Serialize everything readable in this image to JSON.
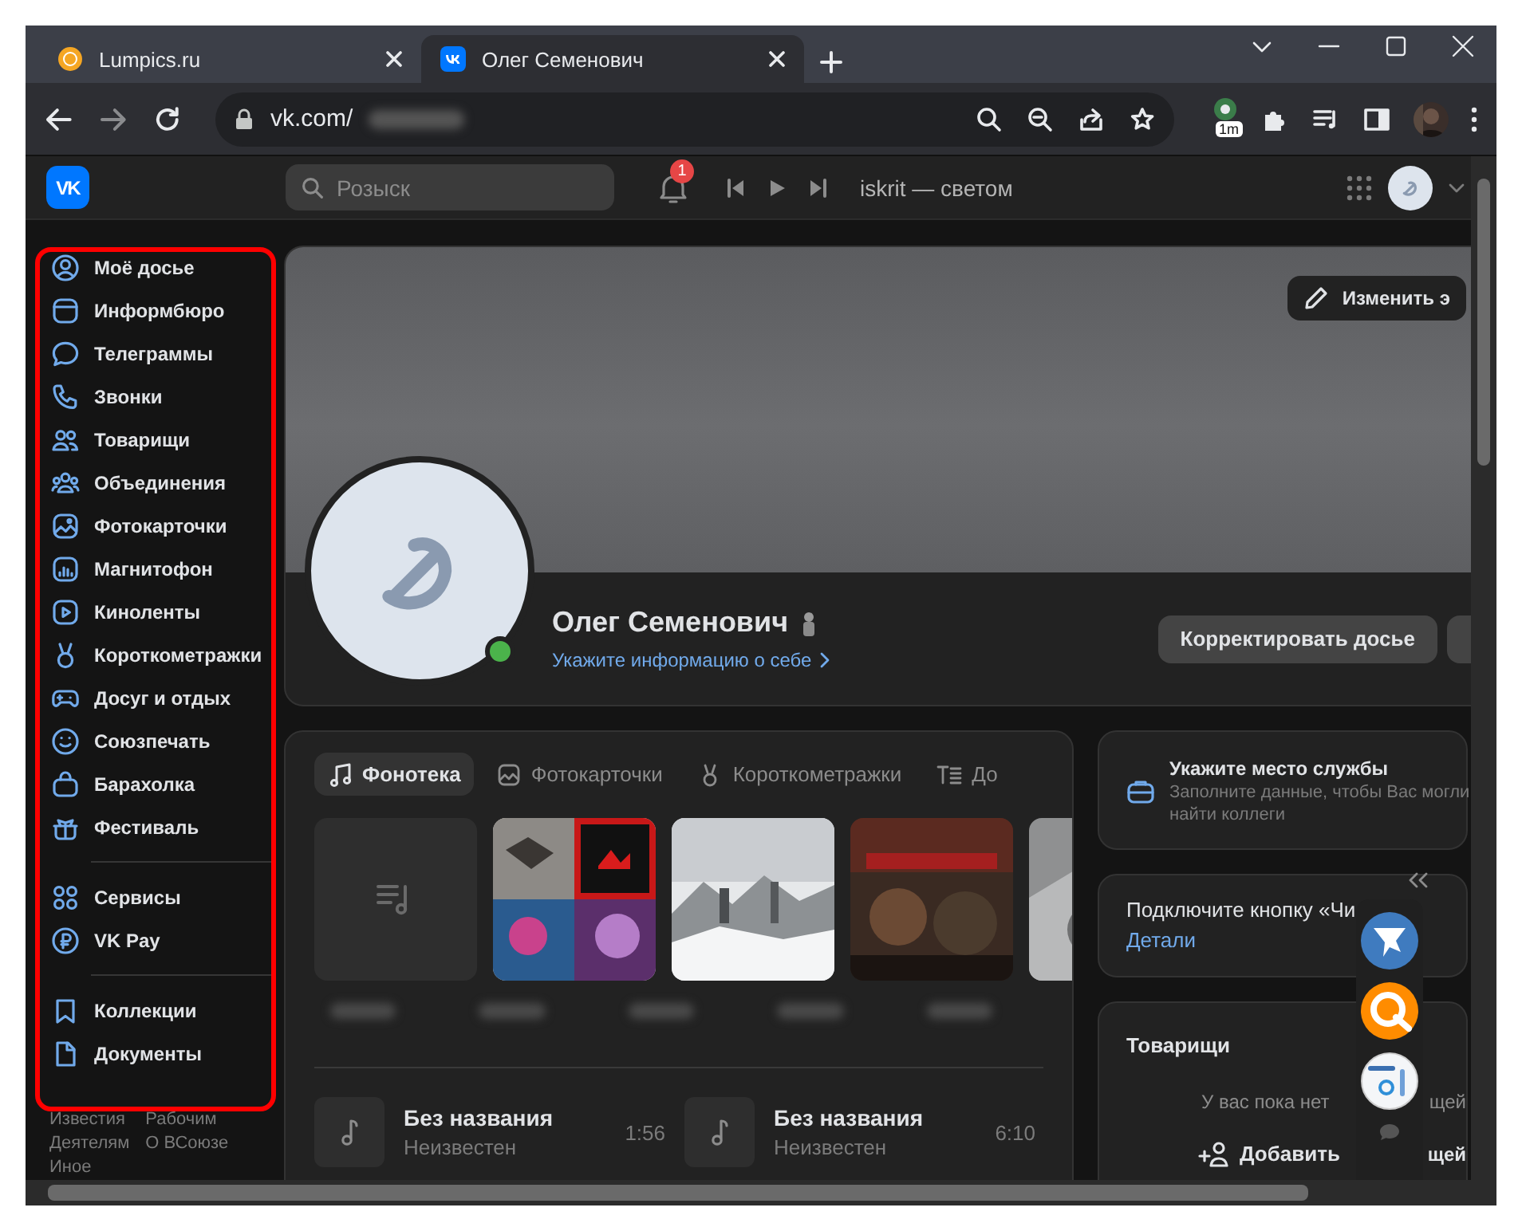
{
  "browser": {
    "tabs": [
      {
        "title": "Lumpics.ru",
        "selected": false
      },
      {
        "title": "Олег Семенович",
        "selected": true
      }
    ],
    "address": "vk.com/",
    "extension_badge": "1m"
  },
  "header": {
    "logo": "VK",
    "search_placeholder": "Розыск",
    "notifications": "1",
    "now_playing": "iskrit — светом"
  },
  "sidebar": {
    "groups": [
      {
        "items": [
          "Моё досье",
          "Информбюро",
          "Телеграммы",
          "Звонки",
          "Товарищи",
          "Объединения",
          "Фотокарточки",
          "Магнитофон",
          "Киноленты",
          "Короткометражки",
          "Досуг и отдых",
          "Союзпечать",
          "Барахолка",
          "Фестиваль"
        ]
      },
      {
        "items": [
          "Сервисы",
          "VK Pay"
        ]
      },
      {
        "items": [
          "Коллекции",
          "Документы"
        ]
      }
    ],
    "footer_links": [
      "Известия",
      "Рабочим",
      "Деятелям",
      "О ВСоюзе",
      "Иное"
    ]
  },
  "profile": {
    "edit_cover": "Изменить э",
    "name": "Олег Семенович",
    "online": true,
    "about_link": "Укажите информацию о себе",
    "edit_button": "Корректировать досье"
  },
  "music": {
    "tabs": [
      {
        "label": "Фонотека",
        "selected": true
      },
      {
        "label": "Фотокарточки",
        "selected": false
      },
      {
        "label": "Короткометражки",
        "selected": false
      },
      {
        "label": "До",
        "selected": false
      }
    ],
    "albums": [
      {
        "kind": "placeholder"
      },
      {
        "kind": "picture"
      },
      {
        "kind": "picture"
      },
      {
        "kind": "picture"
      },
      {
        "kind": "picture"
      }
    ],
    "tracks": [
      {
        "title": "Без названия",
        "artist": "Неизвестен",
        "duration": "1:56"
      },
      {
        "title": "Без названия",
        "artist": "Неизвестен",
        "duration": "6:10"
      }
    ]
  },
  "right": {
    "job": {
      "title": "Укажите место службы",
      "lines": [
        "Заполните данные, чтобы Вас могли",
        "найти коллеги"
      ]
    },
    "button_card": {
      "title": "Подключите кнопку «Чи",
      "link": "Детали"
    },
    "friends": {
      "title": "Товарищи",
      "empty_text": "У вас пока нет",
      "empty_tail": "щей",
      "add": "Добавить",
      "add_tail": "щей"
    }
  }
}
